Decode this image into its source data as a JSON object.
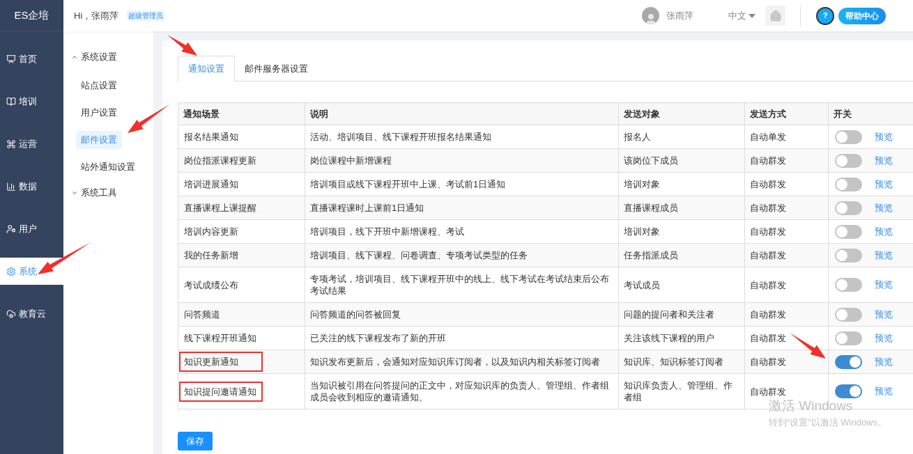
{
  "logo": "ES企培",
  "header": {
    "greeting": "Hi，张雨萍",
    "role_badge": "超级管理员",
    "user_name": "张雨萍",
    "language": "中文",
    "help_icon": "?",
    "help_label": "帮助中心"
  },
  "nav": [
    {
      "label": "首页",
      "selected": false
    },
    {
      "label": "培训",
      "selected": false
    },
    {
      "label": "运营",
      "selected": false
    },
    {
      "label": "数据",
      "selected": false
    },
    {
      "label": "用户",
      "selected": false
    },
    {
      "label": "系统",
      "selected": true
    },
    {
      "label": "教育云",
      "selected": false
    }
  ],
  "submenu": [
    {
      "label": "系统设置",
      "expanded": true,
      "children": [
        {
          "label": "站点设置",
          "selected": false
        },
        {
          "label": "用户设置",
          "selected": false
        },
        {
          "label": "邮件设置",
          "selected": true
        },
        {
          "label": "站外通知设置",
          "selected": false
        }
      ]
    },
    {
      "label": "系统工具",
      "expanded": false
    }
  ],
  "tabs": [
    {
      "label": "通知设置",
      "selected": true
    },
    {
      "label": "邮件服务器设置",
      "selected": false
    }
  ],
  "table": {
    "columns": [
      "通知场景",
      "说明",
      "发送对象",
      "发送方式",
      "开关"
    ],
    "rows": [
      {
        "scene": "报名结果通知",
        "description": "活动、培训项目、线下课程开班报名结果通知",
        "recipients": "报名人",
        "method": "自动单发",
        "on": false,
        "action": "预览",
        "highlighted": false
      },
      {
        "scene": "岗位指派课程更新",
        "description": "岗位课程中新增课程",
        "recipients": "该岗位下成员",
        "method": "自动群发",
        "on": false,
        "action": "预览",
        "highlighted": false
      },
      {
        "scene": "培训进展通知",
        "description": "培训项目或线下课程开班中上课、考试前1日通知",
        "recipients": "培训对象",
        "method": "自动群发",
        "on": false,
        "action": "预览",
        "highlighted": false
      },
      {
        "scene": "直播课程上课提醒",
        "description": "直播课程课时上课前1日通知",
        "recipients": "直播课程成员",
        "method": "自动群发",
        "on": false,
        "action": "预览",
        "highlighted": false
      },
      {
        "scene": "培训内容更新",
        "description": "培训项目，线下开班中新增课程、考试",
        "recipients": "培训对象",
        "method": "自动群发",
        "on": false,
        "action": "预览",
        "highlighted": false
      },
      {
        "scene": "我的任务新增",
        "description": "培训项目、线下课程、问卷调查、专项考试类型的任务",
        "recipients": "任务指派成员",
        "method": "自动群发",
        "on": false,
        "action": "预览",
        "highlighted": false
      },
      {
        "scene": "考试成绩公布",
        "description": "专项考试，培训项目、线下课程开班中的线上、线下考试在考试结束后公布考试结果",
        "recipients": "考试成员",
        "method": "自动群发",
        "on": false,
        "action": "预览",
        "highlighted": false
      },
      {
        "scene": "问答频道",
        "description": "问答频道的问答被回复",
        "recipients": "问题的提问者和关注者",
        "method": "自动群发",
        "on": false,
        "action": "预览",
        "highlighted": false
      },
      {
        "scene": "线下课程开班通知",
        "description": "已关注的线下课程发布了新的开班",
        "recipients": "关注该线下课程的用户",
        "method": "自动群发",
        "on": false,
        "action": "预览",
        "highlighted": false
      },
      {
        "scene": "知识更新通知",
        "description": "知识发布更新后，会通知对应知识库订阅者，以及知识内相关标签订阅者",
        "recipients": "知识库、知识标签订阅者",
        "method": "自动群发",
        "on": true,
        "action": "预览",
        "highlighted": true
      },
      {
        "scene": "知识提问邀请通知",
        "description": "当知识被引用在问答提问的正文中，对应知识库的负责人、管理组、作者组成员会收到相应的邀请通知。",
        "recipients": "知识库负责人、管理组、作者组",
        "method": "自动群发",
        "on": true,
        "action": "预览",
        "highlighted": true
      }
    ]
  },
  "save_button": "保存",
  "os_watermark": {
    "title": "激活 Windows",
    "subtitle": "转到“设置”以激活 Windows。"
  }
}
